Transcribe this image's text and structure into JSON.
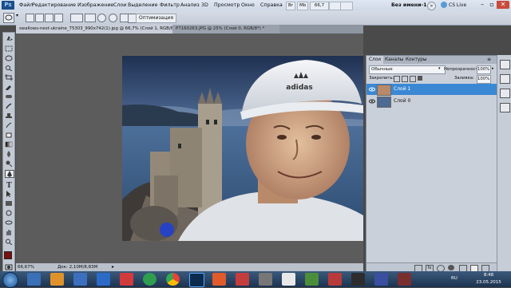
{
  "menu": {
    "logo": "Ps",
    "items": [
      "Файл",
      "Редактирование",
      "Изображение",
      "Слои",
      "Выделение",
      "Фильтр",
      "Анализ",
      "3D",
      "Просмотр",
      "Окно",
      "Справка"
    ],
    "mini_br": "Br",
    "mini_mb": "Mb",
    "zoom": "66,7",
    "workspace": "Без имени-1",
    "cs_live": "CS Live"
  },
  "options_bar": {
    "refine_label": "Оптимизация"
  },
  "tabs": [
    {
      "label": "swallows-nest-ukraine_75303_990x742(1).jpg @ 66,7% (Слой 1, RGB/8#) *",
      "active": true
    },
    {
      "label": "P7160263.JPG @ 25% (Слой 0, RGB/8*) *",
      "active": false
    }
  ],
  "status": {
    "zoom": "66,67%",
    "doc": "Док: 2,10M/8,83M"
  },
  "panel": {
    "tabs": [
      "Слои",
      "Каналы",
      "Контуры"
    ],
    "blend_mode": "Обычные",
    "opacity_label": "Непрозрачность:",
    "opacity_value": "100%",
    "lock_label": "Закрепить:",
    "fill_label": "Заливка:",
    "fill_value": "100%",
    "layers": [
      {
        "name": "Слой 1",
        "selected": true
      },
      {
        "name": "Слой 0",
        "selected": false
      }
    ]
  },
  "taskbar": {
    "lang": "RU",
    "time": "8:48",
    "date": "23.05.2015"
  },
  "colors": {
    "accent_selection": "#3a88d4",
    "foreground_swatch": "#7a1010",
    "background_swatch": "#ffffff"
  }
}
